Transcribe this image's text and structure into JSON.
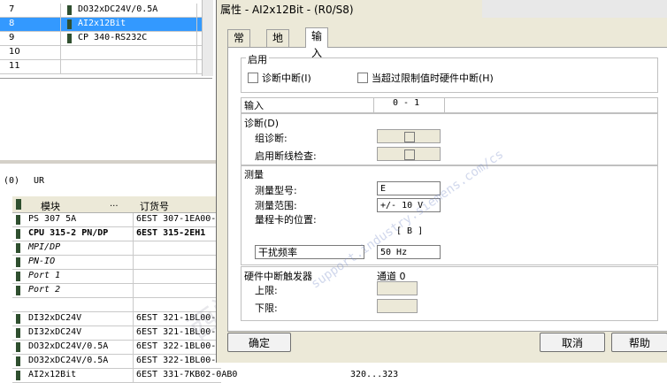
{
  "rack": {
    "rows": [
      {
        "slot": "7",
        "module": "DO32xDC24V/0.5A",
        "selected": false
      },
      {
        "slot": "8",
        "module": "AI2x12Bit",
        "selected": true
      },
      {
        "slot": "9",
        "module": "CP 340-RS232C",
        "selected": false
      },
      {
        "slot": "10",
        "module": "",
        "selected": false
      },
      {
        "slot": "11",
        "module": "",
        "selected": false
      }
    ]
  },
  "station": {
    "address": "(0)",
    "ur": "UR"
  },
  "detail": {
    "headers": {
      "module": "模块",
      "dots": "...",
      "order": "订货号"
    },
    "rows": [
      {
        "module": "PS 307 5A",
        "order": "6EST 307-1EA00-",
        "mark": ""
      },
      {
        "module": "CPU 315-2 PN/DP",
        "order": "6EST 315-2EH1",
        "mark": ""
      },
      {
        "module": "MPI/DP",
        "order": "",
        "mark": "R"
      },
      {
        "module": "PN-IO",
        "order": "",
        "mark": ""
      },
      {
        "module": "Port 1",
        "order": "",
        "mark": "R"
      },
      {
        "module": "Port 2",
        "order": "",
        "mark": "R"
      },
      {
        "module": "",
        "order": "",
        "mark": ""
      },
      {
        "module": "DI32xDC24V",
        "order": "6EST 321-1BL00-",
        "mark": ""
      },
      {
        "module": "DI32xDC24V",
        "order": "6EST 321-1BL00-",
        "mark": ""
      },
      {
        "module": "DO32xDC24V/0.5A",
        "order": "6EST 322-1BL00-",
        "mark": ""
      },
      {
        "module": "DO32xDC24V/0.5A",
        "order": "6EST 322-1BL00-",
        "mark": ""
      },
      {
        "module": "AI2x12Bit",
        "order": "6EST 331-7KB02-0AB0",
        "mark": "",
        "addr": "320...323"
      }
    ]
  },
  "dialog": {
    "title": "属性 - AI2x12Bit - (R0/S8)",
    "tabs": [
      {
        "label": "常规",
        "active": false
      },
      {
        "label": "地址",
        "active": false
      },
      {
        "label": "输入",
        "active": true
      }
    ],
    "enable": {
      "legend": "启用",
      "diag_interrupt": "诊断中断(I)",
      "hw_interrupt": "当超过限制值时硬件中断(H)"
    },
    "table_header": {
      "input": "输入",
      "channel": "0 - 1"
    },
    "diagnostics": {
      "title": "诊断(D)",
      "group_diag": "组诊断:",
      "wire_break": "启用断线检查:"
    },
    "measure": {
      "title": "测量",
      "type_label": "测量型号:",
      "type_value": "E",
      "range_label": "测量范围:",
      "range_value": "+/- 10 V",
      "card_pos_label": "量程卡的位置:",
      "card_pos_value": "[ B ]",
      "interference_label": "干扰频率",
      "interference_value": "50 Hz"
    },
    "hw_trigger": {
      "title": "硬件中断触发器",
      "channel": "通道 0",
      "upper": "上限:",
      "lower": "下限:"
    },
    "buttons": {
      "ok": "确定",
      "cancel": "取消",
      "help": "帮助"
    }
  },
  "watermark": {
    "url": "support.industry.siemens.com/cs"
  }
}
